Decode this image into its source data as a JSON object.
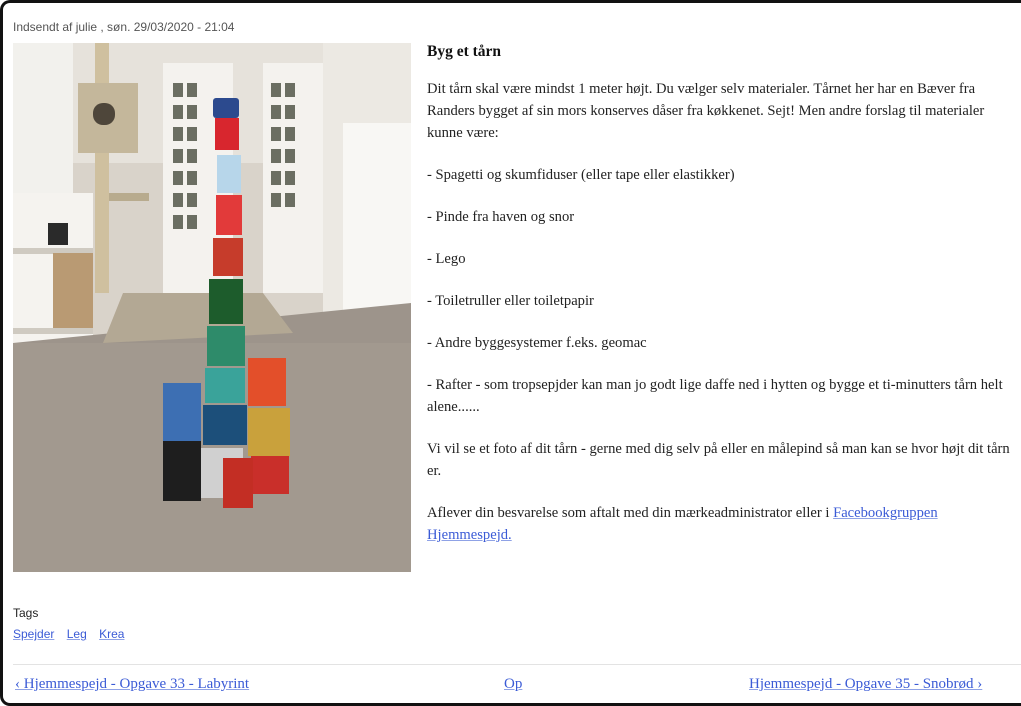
{
  "submitted": "Indsendt af julie , søn. 29/03/2020 - 21:04",
  "article": {
    "title": "Byg et tårn",
    "intro": "Dit tårn skal være mindst 1 meter højt. Du vælger selv materialer. Tårnet her har en Bæver fra Randers bygget af sin mors konserves dåser fra køkkenet. Sejt! Men andre forslag til materialer kunne være:",
    "items": [
      "- Spagetti og skumfiduser (eller tape eller elastikker)",
      "- Pinde fra haven og snor",
      "- Lego",
      "- Toiletruller eller toiletpapir",
      "- Andre byggesystemer f.eks. geomac",
      "- Rafter - som tropsepjder kan man jo godt lige daffe ned i hytten og bygge et ti-minutters tårn helt alene......"
    ],
    "photo_request": "Vi vil se et foto af dit tårn - gerne med dig selv på eller en målepind så man kan se hvor højt dit tårn er.",
    "deliver_text": "Aflever din besvarelse som aftalt med din mærkeadministrator eller i",
    "deliver_link": "Facebookgruppen Hjemmespejd."
  },
  "tags": {
    "title": "Tags",
    "items": [
      "Spejder",
      "Leg",
      "Krea"
    ]
  },
  "pager": {
    "prev": "‹ Hjemmespejd - Opgave 33 - Labyrint",
    "up": "Op",
    "next": "Hjemmespejd - Opgave 35 - Snobrød ›"
  },
  "colors": {
    "link": "#3b5bd6",
    "text": "#222222",
    "meta": "#555555"
  }
}
